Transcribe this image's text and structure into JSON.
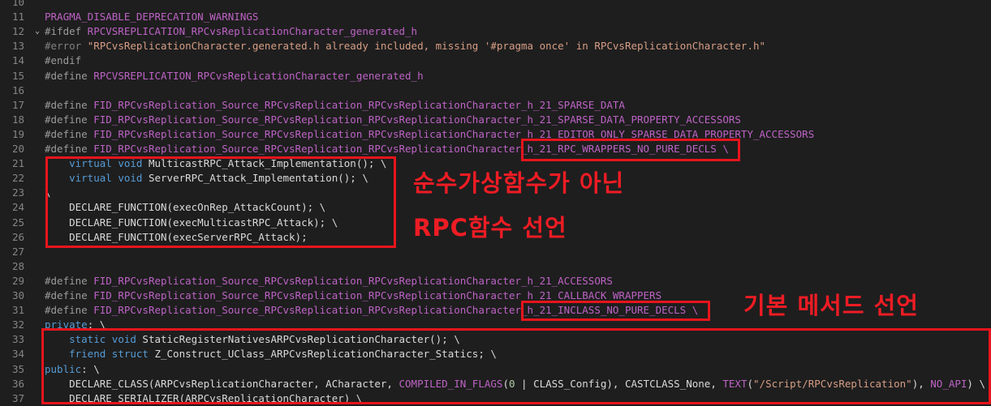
{
  "editor": {
    "lines": [
      {
        "n": "10",
        "text": ""
      },
      {
        "n": "11",
        "text": "PRAGMA_DISABLE_DEPRECATION_WARNINGS"
      },
      {
        "n": "12",
        "text": "#ifdef RPCVSREPLICATION_RPCvsReplicationCharacter_generated_h"
      },
      {
        "n": "13",
        "text": "#error \"RPCvsReplicationCharacter.generated.h already included, missing '#pragma once' in RPCvsReplicationCharacter.h\""
      },
      {
        "n": "14",
        "text": "#endif"
      },
      {
        "n": "15",
        "text": "#define RPCVSREPLICATION_RPCvsReplicationCharacter_generated_h"
      },
      {
        "n": "16",
        "text": ""
      },
      {
        "n": "17",
        "text": "#define FID_RPCvsReplication_Source_RPCvsReplication_RPCvsReplicationCharacter_h_21_SPARSE_DATA"
      },
      {
        "n": "18",
        "text": "#define FID_RPCvsReplication_Source_RPCvsReplication_RPCvsReplicationCharacter_h_21_SPARSE_DATA_PROPERTY_ACCESSORS"
      },
      {
        "n": "19",
        "text": "#define FID_RPCvsReplication_Source_RPCvsReplication_RPCvsReplicationCharacter_h_21_EDITOR_ONLY_SPARSE_DATA_PROPERTY_ACCESSORS"
      },
      {
        "n": "20",
        "text": "#define FID_RPCvsReplication_Source_RPCvsReplication_RPCvsReplicationCharacter_h_21_RPC_WRAPPERS_NO_PURE_DECLS \\"
      },
      {
        "n": "21",
        "text": "    virtual void MulticastRPC_Attack_Implementation(); \\"
      },
      {
        "n": "22",
        "text": "    virtual void ServerRPC_Attack_Implementation(); \\"
      },
      {
        "n": "23",
        "text": "\\"
      },
      {
        "n": "24",
        "text": "    DECLARE_FUNCTION(execOnRep_AttackCount); \\"
      },
      {
        "n": "25",
        "text": "    DECLARE_FUNCTION(execMulticastRPC_Attack); \\"
      },
      {
        "n": "26",
        "text": "    DECLARE_FUNCTION(execServerRPC_Attack);"
      },
      {
        "n": "27",
        "text": ""
      },
      {
        "n": "28",
        "text": ""
      },
      {
        "n": "29",
        "text": "#define FID_RPCvsReplication_Source_RPCvsReplication_RPCvsReplicationCharacter_h_21_ACCESSORS"
      },
      {
        "n": "30",
        "text": "#define FID_RPCvsReplication_Source_RPCvsReplication_RPCvsReplicationCharacter_h_21_CALLBACK_WRAPPERS"
      },
      {
        "n": "31",
        "text": "#define FID_RPCvsReplication_Source_RPCvsReplication_RPCvsReplicationCharacter_h_21_INCLASS_NO_PURE_DECLS \\"
      },
      {
        "n": "32",
        "text": "private: \\"
      },
      {
        "n": "33",
        "text": "    static void StaticRegisterNativesARPCvsReplicationCharacter(); \\"
      },
      {
        "n": "34",
        "text": "    friend struct Z_Construct_UClass_ARPCvsReplicationCharacter_Statics; \\"
      },
      {
        "n": "35",
        "text": "public: \\"
      },
      {
        "n": "36",
        "text": "    DECLARE_CLASS(ARPCvsReplicationCharacter, ACharacter, COMPILED_IN_FLAGS(0 | CLASS_Config), CASTCLASS_None, TEXT(\"/Script/RPCvsReplication\"), NO_API) \\"
      },
      {
        "n": "37",
        "text": "    DECLARE_SERIALIZER(ARPCvsReplicationCharacter) \\"
      }
    ]
  },
  "annotations": {
    "note1_line1": "순수가상함수가 아닌",
    "note1_line2": "RPC함수 선언",
    "note2": "기본 메서드 선언"
  },
  "colors": {
    "background": "#1e1e1e",
    "annotation_red": "#e8141c",
    "keyword": "#569cd6",
    "macro": "#bd63c5",
    "string": "#d69d85",
    "preprocessor": "#9b9b9b"
  }
}
